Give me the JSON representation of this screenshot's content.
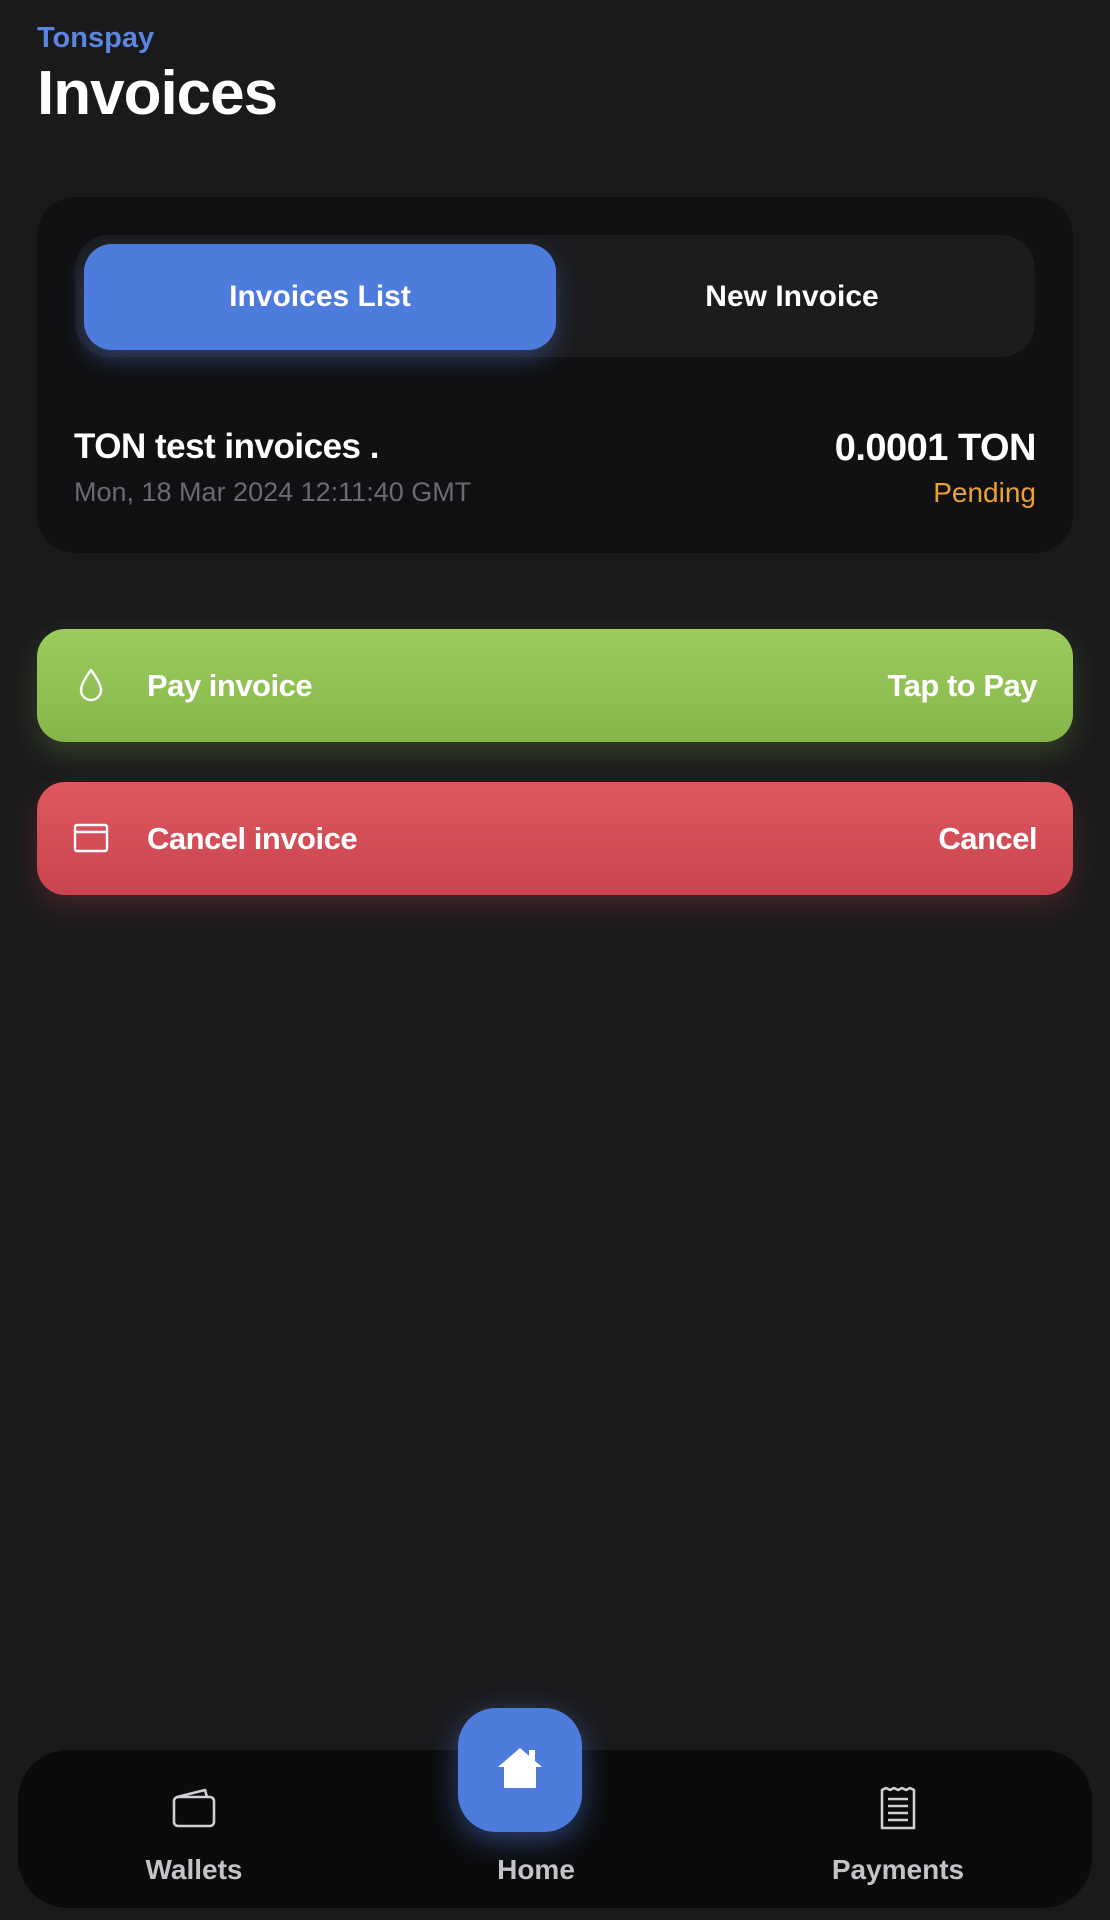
{
  "header": {
    "brand": "Tonspay",
    "title": "Invoices"
  },
  "tabs": [
    {
      "label": "Invoices List",
      "active": true
    },
    {
      "label": "New Invoice",
      "active": false
    }
  ],
  "invoice": {
    "name": "TON test invoices .",
    "date": "Mon, 18 Mar 2024 12:11:40 GMT",
    "amount": "0.0001 TON",
    "status": "Pending",
    "status_color": "#e8a23a"
  },
  "actions": {
    "pay": {
      "label": "Pay invoice",
      "right_label": "Tap to Pay",
      "icon": "droplet-icon",
      "color": "#8dbd50"
    },
    "cancel": {
      "label": "Cancel invoice",
      "right_label": "Cancel",
      "icon": "card-icon",
      "color": "#d54d56"
    }
  },
  "nav": {
    "wallets": {
      "label": "Wallets",
      "icon": "wallet-icon"
    },
    "home": {
      "label": "Home",
      "icon": "home-icon"
    },
    "payments": {
      "label": "Payments",
      "icon": "receipt-icon"
    }
  },
  "colors": {
    "accent": "#4e7cdc",
    "background": "#1a1a1c"
  }
}
